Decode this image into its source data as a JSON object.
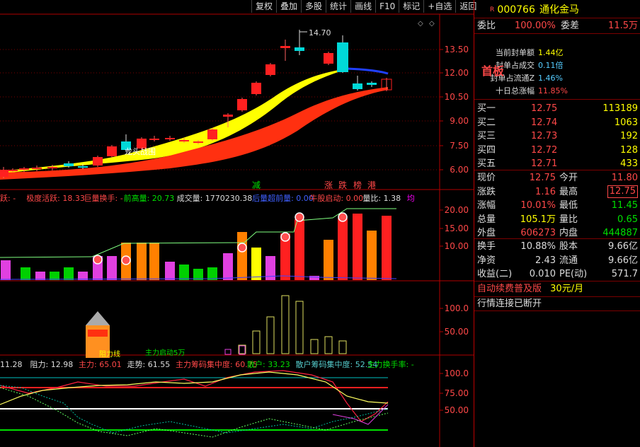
{
  "toolbar": [
    "复权",
    "叠加",
    "多股",
    "统计",
    "画线",
    "F10",
    "标记",
    "+自选",
    "返回"
  ],
  "colors": {
    "up": "#ff2020",
    "down": "#00d8d8",
    "ma_yellow": "#ffff00",
    "ma_red": "#ff3010",
    "grid": "#7a0000",
    "bg": "#000000"
  },
  "main_chart": {
    "peak_label": "14.70",
    "y_ticks": [
      "13.50",
      "12.00",
      "10.50",
      "9.00",
      "7.50",
      "6.00"
    ],
    "event_tags": [
      "减",
      "涨",
      "跌",
      "榜",
      "港"
    ],
    "annotation": "龙头战围"
  },
  "indicator1": {
    "legend": [
      {
        "text": "跃: -",
        "color": "#ff4848"
      },
      {
        "text": "极度活跃: 18.33",
        "color": "#ff4848"
      },
      {
        "text": "巨量换手: -",
        "color": "#ff4848"
      },
      {
        "text": "前高量: 20.73",
        "color": "#00e000"
      },
      {
        "text": "成交量: 1770230.38",
        "color": "#dddddd"
      },
      {
        "text": "后量超前量: 0.00",
        "color": "#4060ff"
      },
      {
        "text": "牛股启动: 0.00",
        "color": "#ff4848"
      },
      {
        "text": "量比: 1.38",
        "color": "#dddddd"
      },
      {
        "text": "均",
        "color": "#ff00ff"
      }
    ],
    "y_ticks": [
      "20.00",
      "15.00",
      "10.00"
    ]
  },
  "indicator2": {
    "y_ticks": [
      "100.0",
      "50.00"
    ],
    "labels": [
      "阻力线",
      "主力启动5万"
    ]
  },
  "indicator3": {
    "legend": [
      {
        "text": "11.28",
        "color": "#dddddd"
      },
      {
        "text": "阻力: 12.98",
        "color": "#dddddd"
      },
      {
        "text": "主力: 65.01",
        "color": "#ff4848"
      },
      {
        "text": "走势: 61.55",
        "color": "#dddddd"
      },
      {
        "text": "主力筹码集中度: 60.75",
        "color": "#ff4848"
      },
      {
        "text": "散户: 33.23",
        "color": "#00e000"
      },
      {
        "text": "散户筹码集中度: 52.54",
        "color": "#5cc"
      },
      {
        "text": "主力换手率: -",
        "color": "#00e000"
      }
    ],
    "y_ticks": [
      "100.0",
      "75.00",
      "50.00"
    ]
  },
  "quote": {
    "code": "000766",
    "name": "通化金马",
    "weibi_label": "委比",
    "weibi_value": "100.00%",
    "weicha_label": "委差",
    "weicha_value": "11.5万",
    "board_label": "首板",
    "seal_info": [
      {
        "label": "当前封单额",
        "value": "1.44亿",
        "color": "#ffff00"
      },
      {
        "label": "封单占成交",
        "value": "0.11倍",
        "color": "#5cf"
      },
      {
        "label": "封单占流通Z",
        "value": "1.46%",
        "color": "#5cf"
      },
      {
        "label": "十日总涨幅",
        "value": "11.85%",
        "color": "#ff4848"
      }
    ],
    "order_book": [
      {
        "label": "买一",
        "price": "12.75",
        "volume": "113189"
      },
      {
        "label": "买二",
        "price": "12.74",
        "volume": "1063"
      },
      {
        "label": "买三",
        "price": "12.73",
        "volume": "192"
      },
      {
        "label": "买四",
        "price": "12.72",
        "volume": "128"
      },
      {
        "label": "买五",
        "price": "12.71",
        "volume": "433"
      }
    ],
    "stats": [
      {
        "l1": "现价",
        "v1": "12.75",
        "c1": "#ff4848",
        "l2": "今开",
        "v2": "11.80",
        "c2": "#ff4848"
      },
      {
        "l1": "涨跌",
        "v1": "1.16",
        "c1": "#ff4848",
        "l2": "最高",
        "v2": "12.75",
        "c2": "#ff4848"
      },
      {
        "l1": "涨幅",
        "v1": "10.01%",
        "c1": "#ff4848",
        "l2": "最低",
        "v2": "11.45",
        "c2": "#00e000"
      },
      {
        "l1": "总量",
        "v1": "105.1万",
        "c1": "#ffff00",
        "l2": "量比",
        "v2": "0.65",
        "c2": "#00e000"
      },
      {
        "l1": "外盘",
        "v1": "606273",
        "c1": "#ff4848",
        "l2": "内盘",
        "v2": "444887",
        "c2": "#00e000"
      }
    ],
    "stats2": [
      {
        "l1": "换手",
        "v1": "10.88%",
        "c1": "#dddddd",
        "l2": "股本",
        "v2": "9.66亿",
        "c2": "#dddddd"
      },
      {
        "l1": "净资",
        "v1": "2.43",
        "c1": "#dddddd",
        "l2": "流通",
        "v2": "9.66亿",
        "c2": "#dddddd"
      },
      {
        "l1": "收益(二)",
        "v1": "0.010",
        "c1": "#dddddd",
        "l2": "PE(动)",
        "v2": "571.7",
        "c2": "#dddddd"
      }
    ],
    "footer1_label": "自动续费普及版",
    "footer1_price": "30元/月",
    "footer2": "行情连接已断开"
  }
}
